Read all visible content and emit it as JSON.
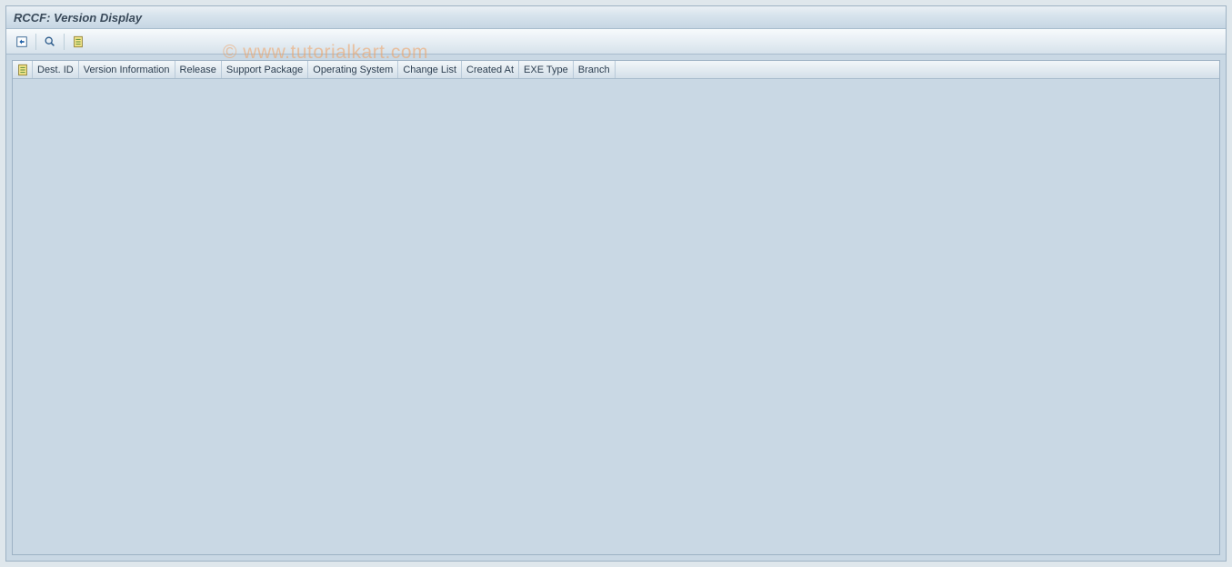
{
  "window": {
    "title": "RCCF: Version Display"
  },
  "toolbar": {
    "icons": {
      "refresh": "refresh-icon",
      "search": "search-icon",
      "report": "report-icon"
    }
  },
  "table": {
    "columns": [
      "Dest. ID",
      "Version Information",
      "Release",
      "Support Package",
      "Operating System",
      "Change List",
      "Created At",
      "EXE Type",
      "Branch"
    ]
  },
  "watermark": "© www.tutorialkart.com"
}
